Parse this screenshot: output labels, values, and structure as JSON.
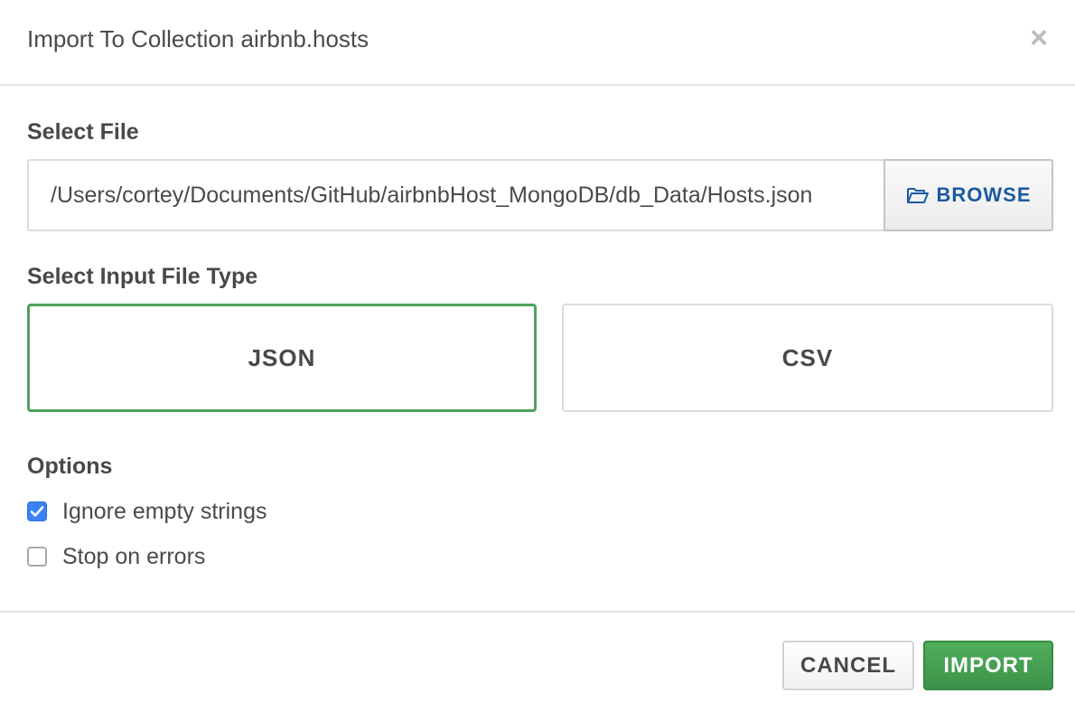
{
  "dialog": {
    "title": "Import To Collection airbnb.hosts",
    "close_icon": "close-icon"
  },
  "select_file": {
    "label": "Select File",
    "path_value": "/Users/cortey/Documents/GitHub/airbnbHost_MongoDB/db_Data/Hosts.json",
    "browse_label": "BROWSE",
    "browse_icon": "folder-open-icon"
  },
  "file_type": {
    "label": "Select Input File Type",
    "options": [
      {
        "label": "JSON",
        "selected": true
      },
      {
        "label": "CSV",
        "selected": false
      }
    ]
  },
  "options": {
    "label": "Options",
    "items": [
      {
        "label": "Ignore empty strings",
        "checked": true
      },
      {
        "label": "Stop on errors",
        "checked": false
      }
    ]
  },
  "footer": {
    "cancel_label": "CANCEL",
    "import_label": "IMPORT"
  },
  "colors": {
    "accent_green": "#4ea35a",
    "import_button": "#45a052",
    "link_blue": "#1a5aa0",
    "checkbox_blue": "#3b82f6"
  }
}
